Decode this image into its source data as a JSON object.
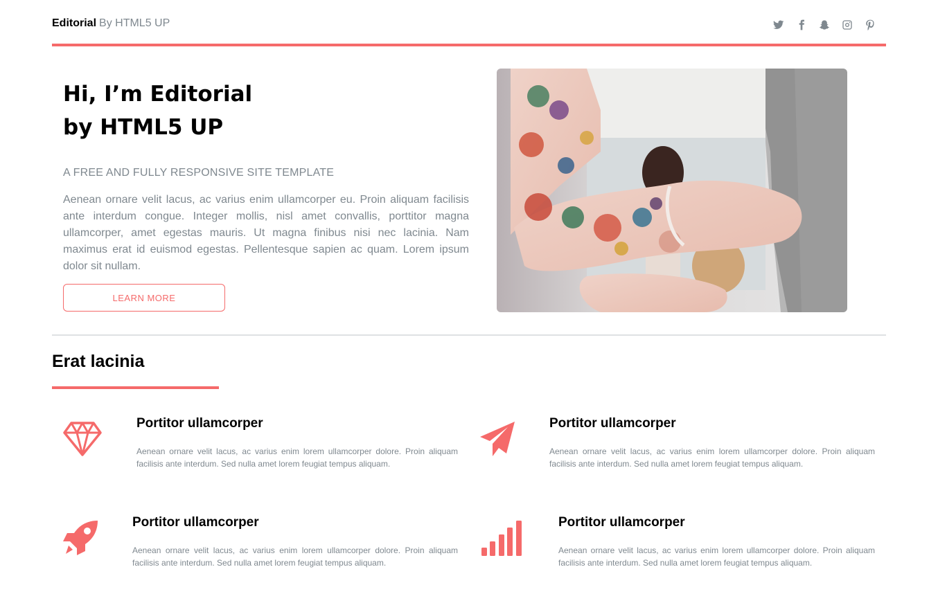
{
  "header": {
    "logo_bold": "Editorial",
    "logo_rest": "By HTML5 UP",
    "social": [
      "twitter-icon",
      "facebook-icon",
      "snapchat-icon",
      "instagram-icon",
      "pinterest-icon"
    ]
  },
  "banner": {
    "title_line1": "Hi, I’m Editorial",
    "title_line2": "by HTML5 UP",
    "subtitle": "A FREE AND FULLY RESPONSIVE SITE TEMPLATE",
    "body": "Aenean ornare velit lacus, ac varius enim ullamcorper eu. Proin aliquam facilisis ante interdum congue. Integer mollis, nisl amet convallis, porttitor magna ullamcorper, amet egestas mauris. Ut magna finibus nisi nec lacinia. Nam maximus erat id euismod egestas. Pellentesque sapien ac quam. Lorem ipsum dolor sit nullam.",
    "button": "LEARN MORE"
  },
  "section": {
    "title": "Erat lacinia",
    "features": [
      {
        "icon": "diamond-icon",
        "title": "Portitor ullamcorper",
        "text": "Aenean ornare velit lacus, ac varius enim lorem ullamcorper dolore. Proin aliquam facilisis ante interdum. Sed nulla amet lorem feugiat tempus aliquam."
      },
      {
        "icon": "paper-plane-icon",
        "title": "Portitor ullamcorper",
        "text": "Aenean ornare velit lacus, ac varius enim lorem ullamcorper dolore. Proin aliquam facilisis ante interdum. Sed nulla amet lorem feugiat tempus aliquam."
      },
      {
        "icon": "rocket-icon",
        "title": "Portitor ullamcorper",
        "text": "Aenean ornare velit lacus, ac varius enim lorem ullamcorper dolore. Proin aliquam facilisis ante interdum. Sed nulla amet lorem feugiat tempus aliquam."
      },
      {
        "icon": "signal-icon",
        "title": "Portitor ullamcorper",
        "text": "Aenean ornare velit lacus, ac varius enim lorem ullamcorper dolore. Proin aliquam facilisis ante interdum. Sed nulla amet lorem feugiat tempus aliquam."
      }
    ]
  },
  "colors": {
    "accent": "#f56a6a",
    "text": "#7f888f",
    "heading": "#000000"
  }
}
